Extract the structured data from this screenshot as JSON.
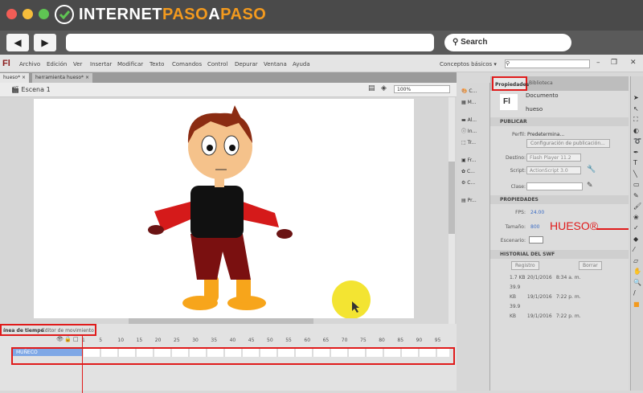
{
  "site": {
    "logo_text_a": "INTERNET",
    "logo_text_b": "PASO",
    "logo_text_c": "A",
    "logo_text_d": "PASO",
    "search_label": "Search"
  },
  "app": {
    "logo": "Fl",
    "menu": [
      "Archivo",
      "Edición",
      "Ver",
      "Insertar",
      "Modificar",
      "Texto",
      "Comandos",
      "Control",
      "Depurar",
      "Ventana",
      "Ayuda"
    ],
    "workspace": "Conceptos básicos ▾"
  },
  "doc_tabs": [
    {
      "label": "hueso*"
    },
    {
      "label": "herramienta hueso*"
    }
  ],
  "scene": {
    "label": "Escena 1",
    "zoom": "100%"
  },
  "panel_icons": [
    "C...",
    "M...",
    "Al...",
    "In...",
    "Tr...",
    "Fr...",
    "C...",
    "C...",
    "Pr..."
  ],
  "properties": {
    "tab_active": "Propiedades",
    "tab_other": "Biblioteca",
    "doc_icon": "Fl",
    "doc_type": "Documento",
    "doc_name": "hueso",
    "publish_header": "PUBLICAR",
    "profile_label": "Perfil:",
    "profile_value": "Predetermina...",
    "publish_settings": "Configuración de publicación...",
    "target_label": "Destino:",
    "target_value": "Flash Player 11.2",
    "script_label": "Script:",
    "script_value": "ActionScript 3.0",
    "class_label": "Clase:",
    "props_header": "PROPIEDADES",
    "fps_label": "FPS:",
    "fps_value": "24.00",
    "size_label": "Tamaño:",
    "size_value": "800",
    "stage_label": "Escenario:",
    "history_header": "HISTORIAL DEL SWF",
    "log_button": "Registro",
    "clear_button": "Borrar",
    "history": [
      {
        "size": "1.7 KB",
        "date": "20/1/2016",
        "time": "8:34 a. m."
      },
      {
        "size": "39.9 KB",
        "date": "19/1/2016",
        "time": "7:22 p. m."
      },
      {
        "size": "39.9 KB",
        "date": "19/1/2016",
        "time": "7:22 p. m."
      }
    ]
  },
  "annotation": {
    "label": "HUESO®",
    "color": "#e01b1b"
  },
  "timeline": {
    "tab_active": "ínea de tiempo",
    "tab_other": "Editor de movimiento",
    "layer": "MUÑECO",
    "frames": [
      "1",
      "5",
      "10",
      "15",
      "20",
      "25",
      "30",
      "35",
      "40",
      "45",
      "50",
      "55",
      "60",
      "65",
      "70",
      "75",
      "80",
      "85",
      "90",
      "95"
    ]
  }
}
